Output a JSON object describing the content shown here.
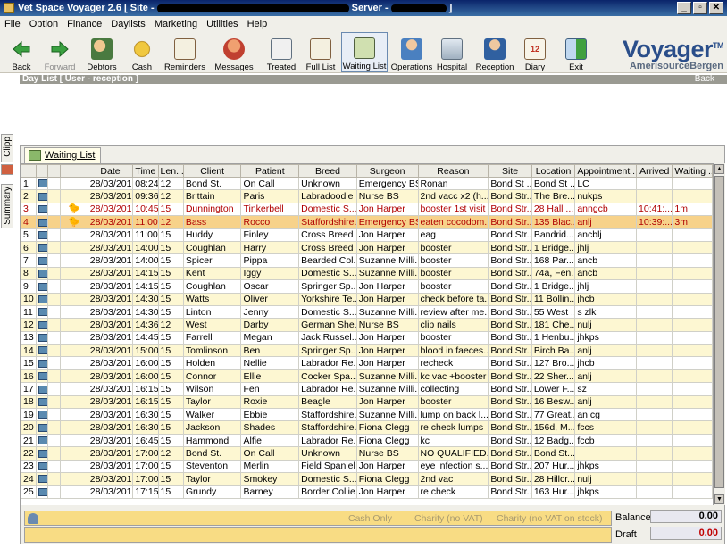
{
  "window": {
    "title_prefix": "Vet Space Voyager 2.6 [ Site - ",
    "title_mid": " Server - ",
    "title_suffix": " ]",
    "min": "_",
    "max": "▫",
    "close": "✕"
  },
  "menu": [
    "File",
    "Option",
    "Finance",
    "Daylists",
    "Marketing",
    "Utilities",
    "Help"
  ],
  "toolbar": [
    {
      "label": "Back",
      "icon": "back-arrow-icon"
    },
    {
      "label": "Forward",
      "icon": "forward-arrow-icon"
    },
    {
      "label": "Debtors",
      "icon": "debtors-icon"
    },
    {
      "label": "Cash",
      "icon": "cash-icon"
    },
    {
      "label": "Reminders",
      "icon": "reminders-icon"
    },
    {
      "label": "Messages",
      "icon": "messages-icon"
    },
    {
      "label": "Treated",
      "icon": "treated-icon"
    },
    {
      "label": "Full List",
      "icon": "full-list-icon"
    },
    {
      "label": "Waiting List",
      "icon": "waiting-list-icon"
    },
    {
      "label": "Operations",
      "icon": "operations-icon"
    },
    {
      "label": "Hospital",
      "icon": "hospital-icon"
    },
    {
      "label": "Reception",
      "icon": "reception-icon"
    },
    {
      "label": "Diary",
      "icon": "diary-icon"
    },
    {
      "label": "Exit",
      "icon": "exit-icon"
    }
  ],
  "logo": {
    "main": "Voyager",
    "tm": "TM",
    "sub": "AmerisourceBergen"
  },
  "daylist": {
    "title": "Day List  [ User - reception ]",
    "back": "Back"
  },
  "sidetabs": [
    "Clipp",
    "Summary"
  ],
  "panel_tab": "Waiting List",
  "columns": [
    "",
    "",
    "",
    "",
    "Date",
    "Time",
    "Len...",
    "Client",
    "Patient",
    "Breed",
    "Surgeon",
    "Reason",
    "Site",
    "Location",
    "Appointment ...",
    "Arrived",
    "Waiting ..."
  ],
  "rows": [
    {
      "n": "1",
      "bird": "",
      "date": "28/03/201",
      "time": "08:24",
      "len": "12",
      "client": "Bond St.",
      "patient": "On Call",
      "breed": "Unknown",
      "surgeon": "Emergency BS",
      "reason": "Ronan",
      "site": "Bond St ...",
      "location": "Bond St ...",
      "appt": "LC",
      "arrived": "",
      "waiting": "",
      "style": "odd"
    },
    {
      "n": "2",
      "bird": "",
      "date": "28/03/201",
      "time": "09:36",
      "len": "12",
      "client": "Brittain",
      "patient": "Paris",
      "breed": "Labradoodle",
      "surgeon": "Nurse BS",
      "reason": "2nd vacc x2  (h...",
      "site": "Bond Str...",
      "location": "The Bre...",
      "appt": "nukps",
      "arrived": "",
      "waiting": "",
      "style": "even"
    },
    {
      "n": "3",
      "bird": "birds",
      "date": "28/03/201",
      "time": "10:45",
      "len": "15",
      "client": "Dunnington",
      "patient": "Tinkerbell",
      "breed": "Domestic S...",
      "surgeon": "Jon Harper",
      "reason": "booster 1st visit",
      "site": "Bond Str...",
      "location": "28 Hall ...",
      "appt": "anngcb",
      "arrived": "10:41:...",
      "waiting": "1m",
      "style": "odd red"
    },
    {
      "n": "4",
      "bird": "birds",
      "date": "28/03/201",
      "time": "11:00",
      "len": "12",
      "client": "Bass",
      "patient": "Rocco",
      "breed": "Staffordshire...",
      "surgeon": "Emergency BS",
      "reason": "eaten cocodom...",
      "site": "Bond Str...",
      "location": "135 Blac...",
      "appt": "anlj",
      "arrived": "10:39:...",
      "waiting": "3m",
      "style": "sel red"
    },
    {
      "n": "5",
      "bird": "",
      "date": "28/03/201",
      "time": "11:00",
      "len": "15",
      "client": "Huddy",
      "patient": "Finley",
      "breed": "Cross Breed",
      "surgeon": "Jon Harper",
      "reason": "eag",
      "site": "Bond Str...",
      "location": "Bandrid...",
      "appt": "ancblj",
      "arrived": "",
      "waiting": "",
      "style": "odd"
    },
    {
      "n": "6",
      "bird": "",
      "date": "28/03/201",
      "time": "14:00",
      "len": "15",
      "client": "Coughlan",
      "patient": "Harry",
      "breed": "Cross Breed",
      "surgeon": "Jon Harper",
      "reason": "booster",
      "site": "Bond Str...",
      "location": "1 Bridge...",
      "appt": "jhlj",
      "arrived": "",
      "waiting": "",
      "style": "even"
    },
    {
      "n": "7",
      "bird": "",
      "date": "28/03/201",
      "time": "14:00",
      "len": "15",
      "client": "Spicer",
      "patient": "Pippa",
      "breed": "Bearded Col...",
      "surgeon": "Suzanne Milli...",
      "reason": "booster",
      "site": "Bond Str...",
      "location": "168 Par...",
      "appt": "ancb",
      "arrived": "",
      "waiting": "",
      "style": "odd"
    },
    {
      "n": "8",
      "bird": "",
      "date": "28/03/201",
      "time": "14:15",
      "len": "15",
      "client": "Kent",
      "patient": "Iggy",
      "breed": "Domestic S...",
      "surgeon": "Suzanne Milli...",
      "reason": "booster",
      "site": "Bond Str...",
      "location": "74a, Fen...",
      "appt": "ancb",
      "arrived": "",
      "waiting": "",
      "style": "even"
    },
    {
      "n": "9",
      "bird": "",
      "date": "28/03/201",
      "time": "14:15",
      "len": "15",
      "client": "Coughlan",
      "patient": "Oscar",
      "breed": "Springer Sp...",
      "surgeon": "Jon Harper",
      "reason": "booster",
      "site": "Bond Str...",
      "location": "1 Bridge...",
      "appt": "jhlj",
      "arrived": "",
      "waiting": "",
      "style": "odd"
    },
    {
      "n": "10",
      "bird": "",
      "date": "28/03/201",
      "time": "14:30",
      "len": "15",
      "client": "Watts",
      "patient": "Oliver",
      "breed": "Yorkshire Te...",
      "surgeon": "Jon Harper",
      "reason": "check before ta...",
      "site": "Bond Str...",
      "location": "11 Bollin...",
      "appt": "jhcb",
      "arrived": "",
      "waiting": "",
      "style": "even"
    },
    {
      "n": "11",
      "bird": "",
      "date": "28/03/201",
      "time": "14:30",
      "len": "15",
      "client": "Linton",
      "patient": "Jenny",
      "breed": "Domestic S...",
      "surgeon": "Suzanne Milli...",
      "reason": "review after me...",
      "site": "Bond Str...",
      "location": "55 West ...",
      "appt": "s zlk",
      "arrived": "",
      "waiting": "",
      "style": "odd"
    },
    {
      "n": "12",
      "bird": "",
      "date": "28/03/201",
      "time": "14:36",
      "len": "12",
      "client": "West",
      "patient": "Darby",
      "breed": "German She...",
      "surgeon": "Nurse BS",
      "reason": "clip nails",
      "site": "Bond Str...",
      "location": "181 Che...",
      "appt": "nulj",
      "arrived": "",
      "waiting": "",
      "style": "even"
    },
    {
      "n": "13",
      "bird": "",
      "date": "28/03/201",
      "time": "14:45",
      "len": "15",
      "client": "Farrell",
      "patient": "Megan",
      "breed": "Jack Russel...",
      "surgeon": "Jon Harper",
      "reason": "booster",
      "site": "Bond Str...",
      "location": "1 Henbu...",
      "appt": "jhkps",
      "arrived": "",
      "waiting": "",
      "style": "odd"
    },
    {
      "n": "14",
      "bird": "",
      "date": "28/03/201",
      "time": "15:00",
      "len": "15",
      "client": "Tomlinson",
      "patient": "Ben",
      "breed": "Springer Sp...",
      "surgeon": "Jon Harper",
      "reason": "blood in faeces...",
      "site": "Bond Str...",
      "location": "Birch Ba...",
      "appt": "anlj",
      "arrived": "",
      "waiting": "",
      "style": "even"
    },
    {
      "n": "15",
      "bird": "",
      "date": "28/03/201",
      "time": "16:00",
      "len": "15",
      "client": "Holden",
      "patient": "Nellie",
      "breed": "Labrador Re...",
      "surgeon": "Jon Harper",
      "reason": "recheck",
      "site": "Bond Str...",
      "location": "127 Bro...",
      "appt": "jhcb",
      "arrived": "",
      "waiting": "",
      "style": "odd"
    },
    {
      "n": "16",
      "bird": "",
      "date": "28/03/201",
      "time": "16:00",
      "len": "15",
      "client": "Connor",
      "patient": "Ellie",
      "breed": "Cocker Spa...",
      "surgeon": "Suzanne Milli...",
      "reason": "kc vac +booster",
      "site": "Bond Str...",
      "location": "22 Sher...",
      "appt": "anlj",
      "arrived": "",
      "waiting": "",
      "style": "even"
    },
    {
      "n": "17",
      "bird": "",
      "date": "28/03/201",
      "time": "16:15",
      "len": "15",
      "client": "Wilson",
      "patient": "Fen",
      "breed": "Labrador Re...",
      "surgeon": "Suzanne Milli...",
      "reason": "collecting",
      "site": "Bond Str...",
      "location": "Lower F...",
      "appt": "sz",
      "arrived": "",
      "waiting": "",
      "style": "odd"
    },
    {
      "n": "18",
      "bird": "",
      "date": "28/03/201",
      "time": "16:15",
      "len": "15",
      "client": "Taylor",
      "patient": "Roxie",
      "breed": "Beagle",
      "surgeon": "Jon Harper",
      "reason": "booster",
      "site": "Bond Str...",
      "location": "16 Besw...",
      "appt": "anlj",
      "arrived": "",
      "waiting": "",
      "style": "even"
    },
    {
      "n": "19",
      "bird": "",
      "date": "28/03/201",
      "time": "16:30",
      "len": "15",
      "client": "Walker",
      "patient": "Ebbie",
      "breed": "Staffordshire...",
      "surgeon": "Suzanne Milli...",
      "reason": "lump on back l...",
      "site": "Bond Str...",
      "location": "77 Great...",
      "appt": "an cg",
      "arrived": "",
      "waiting": "",
      "style": "odd"
    },
    {
      "n": "20",
      "bird": "",
      "date": "28/03/201",
      "time": "16:30",
      "len": "15",
      "client": "Jackson",
      "patient": "Shades",
      "breed": "Staffordshire...",
      "surgeon": "Fiona Clegg",
      "reason": "re check lumps",
      "site": "Bond Str...",
      "location": "156d, M...",
      "appt": "fccs",
      "arrived": "",
      "waiting": "",
      "style": "even"
    },
    {
      "n": "21",
      "bird": "",
      "date": "28/03/201",
      "time": "16:45",
      "len": "15",
      "client": "Hammond",
      "patient": "Alfie",
      "breed": "Labrador Re...",
      "surgeon": "Fiona Clegg",
      "reason": "kc",
      "site": "Bond Str...",
      "location": "12 Badg...",
      "appt": "fccb",
      "arrived": "",
      "waiting": "",
      "style": "odd"
    },
    {
      "n": "22",
      "bird": "",
      "date": "28/03/201",
      "time": "17:00",
      "len": "12",
      "client": "Bond St.",
      "patient": "On Call",
      "breed": "Unknown",
      "surgeon": "Nurse BS",
      "reason": "NO QUALIFIED...",
      "site": "Bond Str...",
      "location": "Bond St...",
      "appt": "",
      "arrived": "",
      "waiting": "",
      "style": "even"
    },
    {
      "n": "23",
      "bird": "",
      "date": "28/03/201",
      "time": "17:00",
      "len": "15",
      "client": "Steventon",
      "patient": "Merlin",
      "breed": "Field Spaniel",
      "surgeon": "Jon Harper",
      "reason": "eye infection  s...",
      "site": "Bond Str...",
      "location": "207 Hur...",
      "appt": "jhkps",
      "arrived": "",
      "waiting": "",
      "style": "odd"
    },
    {
      "n": "24",
      "bird": "",
      "date": "28/03/201",
      "time": "17:00",
      "len": "15",
      "client": "Taylor",
      "patient": "Smokey",
      "breed": "Domestic S...",
      "surgeon": "Fiona Clegg",
      "reason": "2nd vac",
      "site": "Bond Str...",
      "location": "28 Hillcr...",
      "appt": "nulj",
      "arrived": "",
      "waiting": "",
      "style": "even"
    },
    {
      "n": "25",
      "bird": "",
      "date": "28/03/201",
      "time": "17:15",
      "len": "15",
      "client": "Grundy",
      "patient": "Barney",
      "breed": "Border Collie",
      "surgeon": "Jon Harper",
      "reason": "re check",
      "site": "Bond Str...",
      "location": "163 Hur...",
      "appt": "jhkps",
      "arrived": "",
      "waiting": "",
      "style": "odd"
    }
  ],
  "footer": {
    "options": [
      "Cash Only",
      "Charity (no VAT)",
      "Charity (no VAT on stock)"
    ],
    "balance_label": "Balance",
    "balance_value": "0.00",
    "draft_label": "Draft",
    "draft_value": "0.00",
    "draft_color": "#c00000"
  }
}
